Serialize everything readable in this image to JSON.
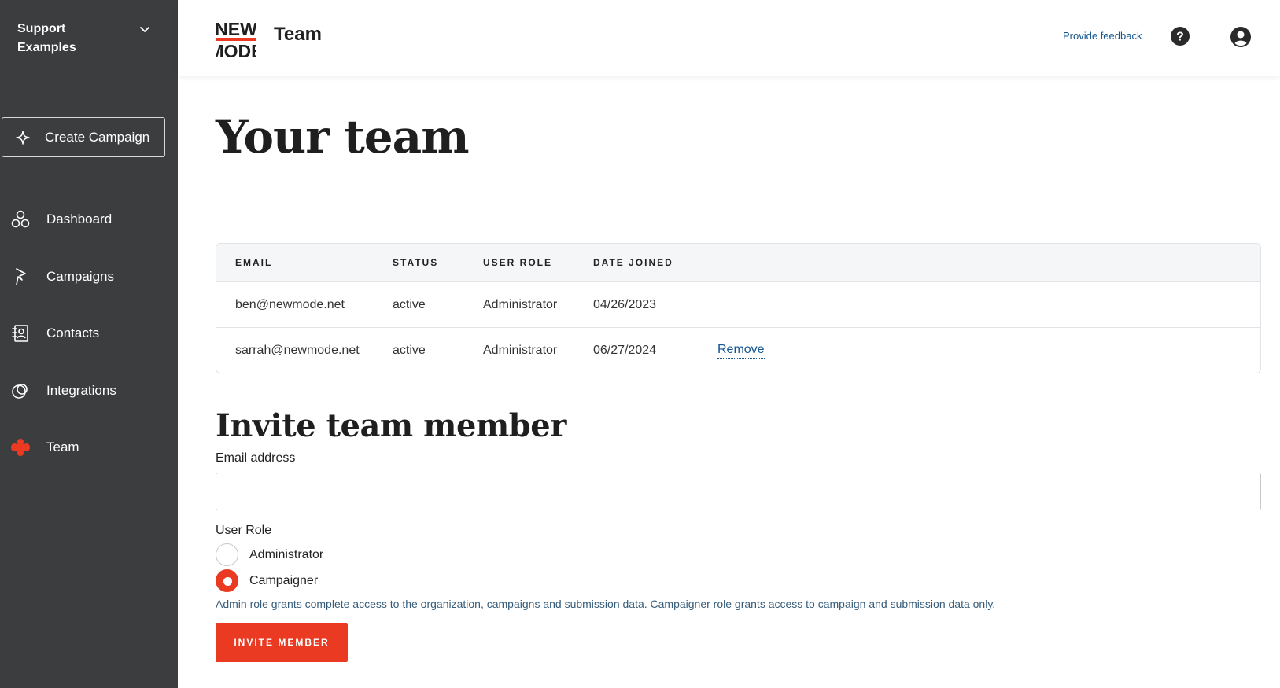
{
  "sidebar": {
    "org_name": "Support Examples",
    "create_label": "Create Campaign",
    "items": [
      {
        "label": "Dashboard",
        "icon": "dashboard-icon"
      },
      {
        "label": "Campaigns",
        "icon": "campaigns-icon"
      },
      {
        "label": "Contacts",
        "icon": "contacts-icon"
      },
      {
        "label": "Integrations",
        "icon": "integrations-icon"
      },
      {
        "label": "Team",
        "icon": "team-icon",
        "active": true
      }
    ]
  },
  "header": {
    "logo_top": "NEW",
    "logo_bottom": "MODE",
    "title": "Team",
    "feedback_label": "Provide feedback"
  },
  "main": {
    "title": "Your team",
    "table": {
      "columns": [
        "EMAIL",
        "STATUS",
        "USER ROLE",
        "DATE JOINED"
      ],
      "rows": [
        {
          "email": "ben@newmode.net",
          "status": "active",
          "role": "Administrator",
          "date": "04/26/2023",
          "action": ""
        },
        {
          "email": "sarrah@newmode.net",
          "status": "active",
          "role": "Administrator",
          "date": "06/27/2024",
          "action": "Remove"
        }
      ]
    },
    "invite": {
      "title": "Invite team member",
      "email_label": "Email address",
      "email_value": "",
      "role_label": "User Role",
      "options": [
        {
          "label": "Administrator",
          "selected": false
        },
        {
          "label": "Campaigner",
          "selected": true
        }
      ],
      "help_text": "Admin role grants complete access to the organization, campaigns and submission data. Campaigner role grants access to campaign and submission data only.",
      "button_label": "INVITE MEMBER"
    }
  },
  "colors": {
    "sidebar_bg": "#3b3d3f",
    "accent": "#ea3a22",
    "link": "#14558f"
  }
}
